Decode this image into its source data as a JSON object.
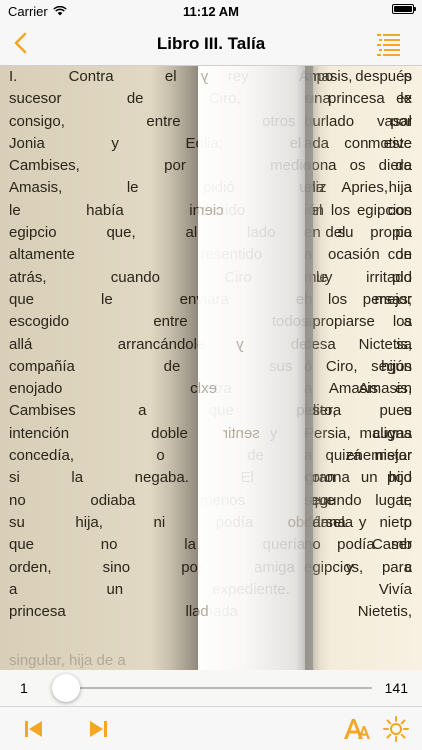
{
  "status_bar": {
    "carrier": "Carrier",
    "time": "11:12 AM"
  },
  "nav": {
    "title": "Libro III. Talía"
  },
  "page": {
    "lines": [
      "I. Contra el rey Amasis, p",
      "sucesor de Ciro, una ex",
      "consigo, entre otros vasal",
      "Jonia y Eolia; el motive",
      "Cambises, por medio de",
      "Amasis, le pidió una hija",
      "le había inducido el con",
      "egipcio que, al lado del pa",
      "altamente resentido con",
      "atrás, cuando Ciro le pid",
      "que le enviara el mejor",
      "escogido entre todos los",
      "allá arrancándole del sa",
      "compañía de sus hijos",
      "enojado contra Amasis,",
      "Cambises a que pidiera u",
      "intención doble y maligna",
      "concedía, o de enemistar",
      "si la negaba. El gran pod",
      "no odiaba menos que te",
      "su hija, ni podía dársela p",
      "que no la quería Camb",
      "orden, sino por amiga y c",
      "a un expediente. Vivía",
      "princesa llamada Nietetis,"
    ],
    "right_lines": [
      "mpo después",
      "n princesa le",
      "burlado por",
      "ada con este",
      "sona os diera",
      "eliz Apries, a",
      "ión los egipcios",
      "en su propio",
      "",
      "",
      "a ocasión de",
      "muy irritado",
      "n los persas;",
      "apropiarse a",
      "cesa Nictetis,",
      "ó Ciro, según",
      "a Amasis en",
      "esto, pues",
      "Persia, cuyas",
      "a quizá mejor",
      "corona un hijo",
      "segundo lugar,",
      "ndana y nieto",
      "no podía ser",
      "egipcios, para"
    ],
    "back_lines": [
      "hijo y mideea,",
      "cual llevaba",
      "griegos de la",
      "la siguiente:",
      "enviado al rey",
      "suya demanda",
      "de cierto Amasis",
      "una trama,",
      "que tiempos",
      "mensajeros",
      "Egipto, le había",
      "sus ojos y",
      "mujer y de la",
      "Este egipcio,",
      "a exhortar a",
      "Egipto con la",
      "que sentir si la",
      "con Cambises",
      "quien Amasis",
      "rehusarlo",
      "comprendiendo",
      "de primera",
      "Apuro acudió",
      "Egipto una",
      "de belleza y"
    ],
    "partial_line": "singular, hija de a"
  },
  "slider": {
    "min_label": "1",
    "max_label": "141",
    "value": 1,
    "min": 1,
    "max": 141
  },
  "colors": {
    "accent": "#f5a623"
  },
  "icons": {
    "back": "chevron-left-icon",
    "toc": "list-icon",
    "prev": "skip-back-icon",
    "next": "skip-forward-icon",
    "font": "font-size-icon",
    "brightness": "sun-icon"
  }
}
